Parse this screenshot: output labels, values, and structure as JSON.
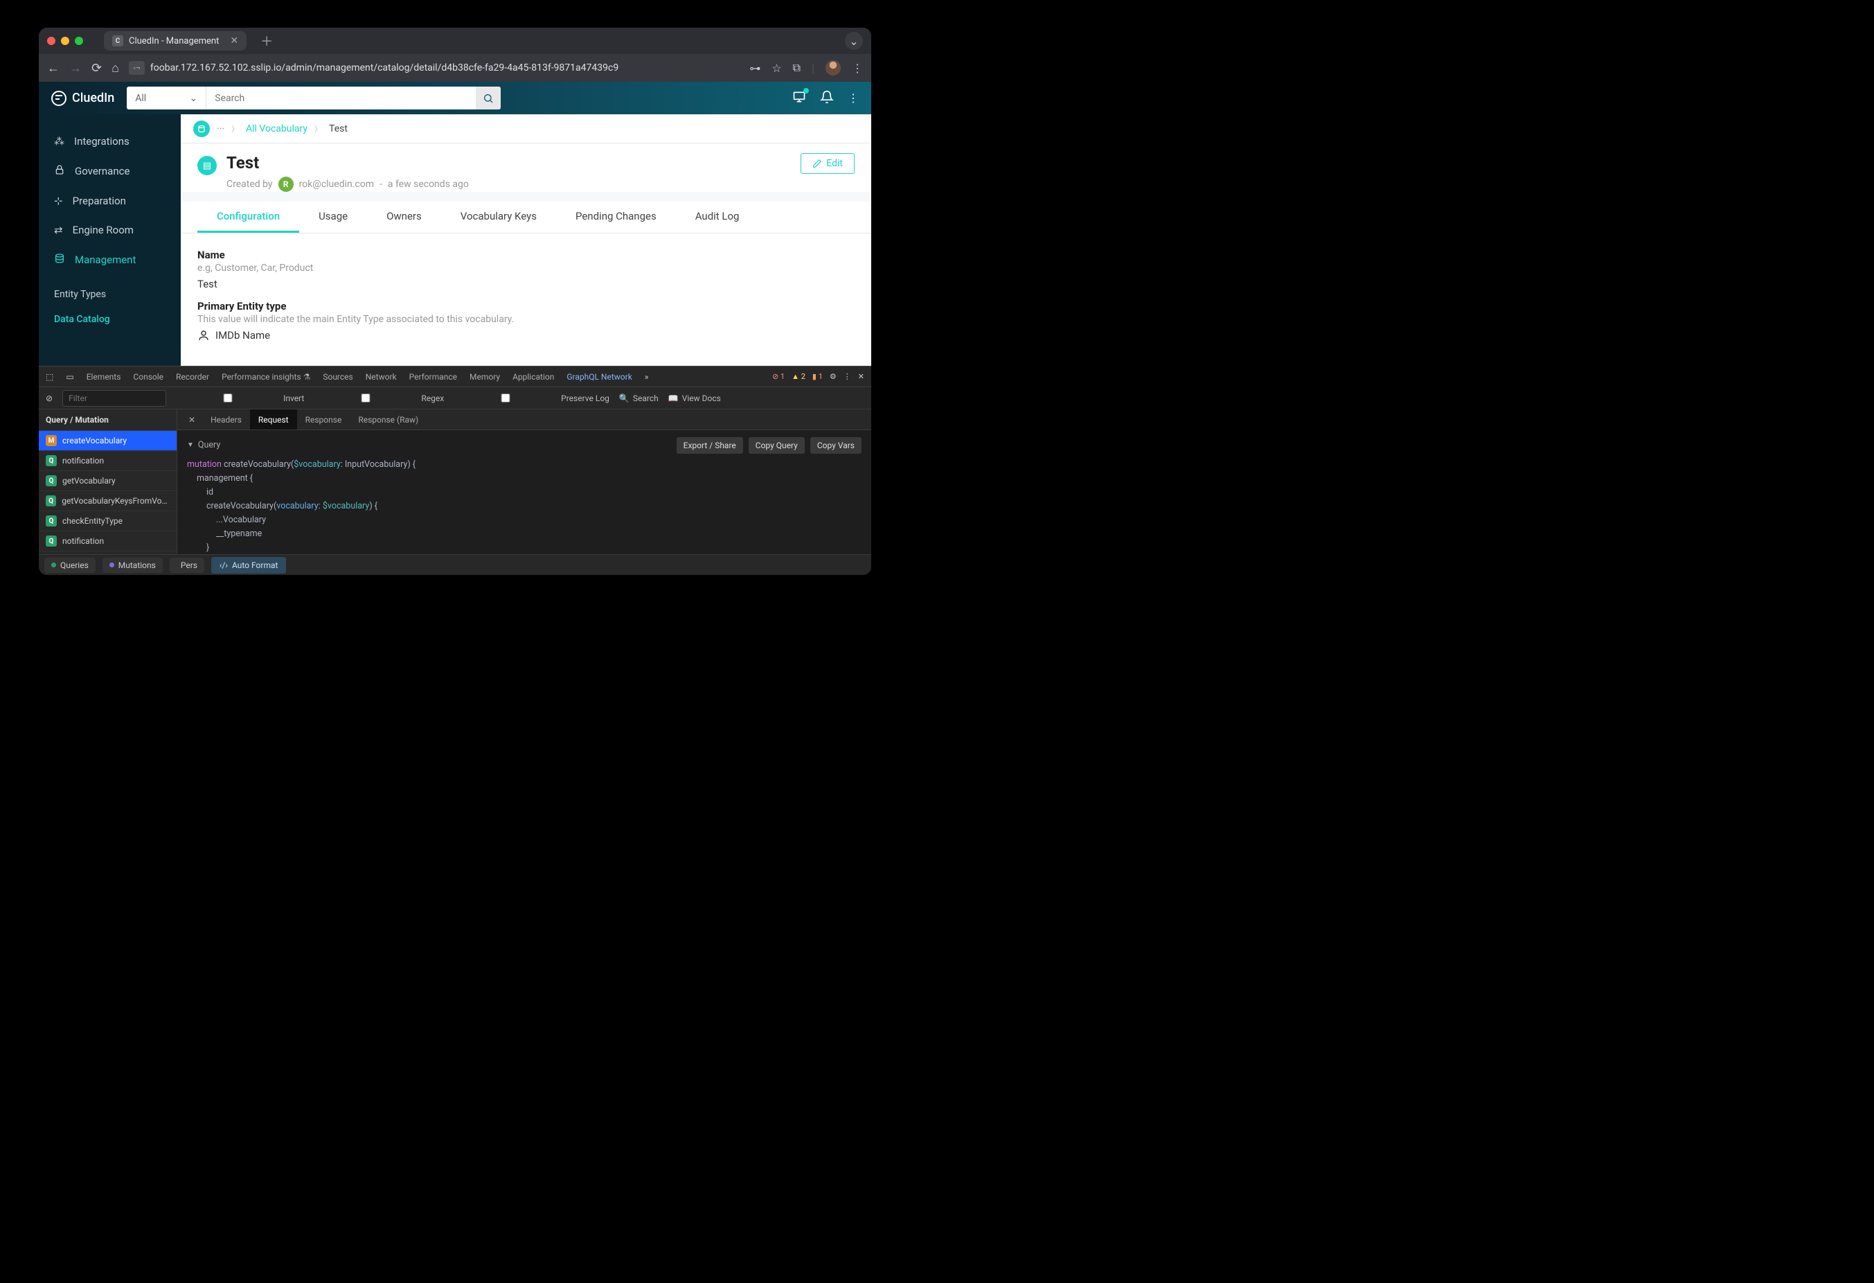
{
  "browser": {
    "tab_title": "CluedIn - Management",
    "url": "foobar.172.167.52.102.sslip.io/admin/management/catalog/detail/d4b38cfe-fa29-4a45-813f-9871a47439c9"
  },
  "header": {
    "logo": "CluedIn",
    "search_scope": "All",
    "search_placeholder": "Search"
  },
  "sidebar": {
    "items": [
      {
        "label": "Integrations",
        "icon": "integrations-icon"
      },
      {
        "label": "Governance",
        "icon": "lock-icon"
      },
      {
        "label": "Preparation",
        "icon": "preparation-icon"
      },
      {
        "label": "Engine Room",
        "icon": "engine-icon"
      },
      {
        "label": "Management",
        "icon": "management-icon",
        "active": true
      }
    ],
    "subitems": [
      {
        "label": "Entity Types"
      },
      {
        "label": "Data Catalog",
        "active": true
      }
    ]
  },
  "breadcrumb": {
    "dots": "···",
    "link": "All Vocabulary",
    "current": "Test"
  },
  "entity": {
    "title": "Test",
    "created_by_label": "Created by",
    "created_by_initial": "R",
    "created_by_email": "rok@cluedin.com",
    "sep": "-",
    "when": "a few seconds ago",
    "edit_label": "Edit"
  },
  "tabs": [
    "Configuration",
    "Usage",
    "Owners",
    "Vocabulary Keys",
    "Pending Changes",
    "Audit Log"
  ],
  "active_tab": "Configuration",
  "fields": {
    "name_label": "Name",
    "name_hint": "e.g, Customer, Car, Product",
    "name_value": "Test",
    "pet_label": "Primary Entity type",
    "pet_hint": "This value will indicate the main Entity Type associated to this vocabulary.",
    "pet_value": "IMDb Name"
  },
  "devtools": {
    "panels": [
      "Elements",
      "Console",
      "Recorder",
      "Performance insights",
      "Sources",
      "Network",
      "Performance",
      "Memory",
      "Application",
      "GraphQL Network"
    ],
    "active_panel": "GraphQL Network",
    "status": {
      "errors": "1",
      "warnings": "2",
      "info": "1"
    },
    "filter": {
      "placeholder": "Filter",
      "invert": "Invert",
      "regex": "Regex",
      "preserve": "Preserve Log",
      "search": "Search",
      "docs": "View Docs"
    },
    "left_header": "Query / Mutation",
    "rows": [
      {
        "badge": "M",
        "name": "createVocabulary",
        "selected": true
      },
      {
        "badge": "Q",
        "name": "notification"
      },
      {
        "badge": "Q",
        "name": "getVocabulary"
      },
      {
        "badge": "Q",
        "name": "getVocabularyKeysFromVocab"
      },
      {
        "badge": "Q",
        "name": "checkEntityType"
      },
      {
        "badge": "Q",
        "name": "notification"
      }
    ],
    "subtabs": [
      "Headers",
      "Request",
      "Response",
      "Response (Raw)"
    ],
    "active_subtab": "Request",
    "query_label": "Query",
    "buttons": {
      "export": "Export / Share",
      "copyq": "Copy Query",
      "copyv": "Copy Vars"
    },
    "code": {
      "l1a": "mutation",
      "l1b": "createVocabulary(",
      "l1c": "$vocabulary",
      "l1d": ": InputVocabulary) {",
      "l2": "management  {",
      "l3": "id",
      "l4a": "createVocabulary(",
      "l4b": "vocabulary",
      "l4c": ": ",
      "l4d": "$vocabulary",
      "l4e": ") {",
      "l5": "...Vocabulary",
      "l6": "__typename",
      "l7": "}"
    },
    "chips": {
      "queries": "Queries",
      "mutations": "Mutations",
      "pers": "Pers"
    },
    "auto_format": "Auto Format"
  }
}
